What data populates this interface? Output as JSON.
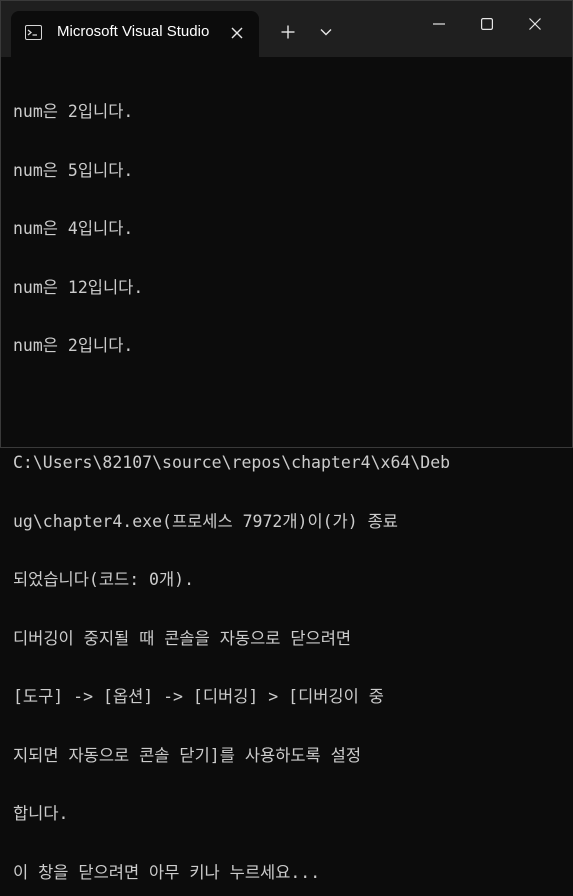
{
  "window": {
    "tab_title": "Microsoft Visual Studio"
  },
  "icons": {
    "tab": "terminal-icon",
    "close_tab": "close-icon",
    "new_tab": "plus-icon",
    "dropdown": "chevron-down-icon",
    "minimize": "minimize-icon",
    "maximize": "maximize-icon",
    "close_window": "close-icon"
  },
  "colors": {
    "titlebar": "#1f1f1f",
    "console_bg": "#0c0c0c",
    "console_text": "#cccccc"
  },
  "console": {
    "lines": [
      "num은 2입니다.",
      "num은 5입니다.",
      "num은 4입니다.",
      "num은 12입니다.",
      "num은 2입니다.",
      "",
      "C:\\Users\\82107\\source\\repos\\chapter4\\x64\\Deb",
      "ug\\chapter4.exe(프로세스 7972개)이(가) 종료",
      "되었습니다(코드: 0개).",
      "디버깅이 중지될 때 콘솔을 자동으로 닫으려면",
      "[도구] -> [옵션] -> [디버깅] > [디버깅이 중",
      "지되면 자동으로 콘솔 닫기]를 사용하도록 설정",
      "합니다.",
      "이 창을 닫으려면 아무 키나 누르세요..."
    ]
  }
}
